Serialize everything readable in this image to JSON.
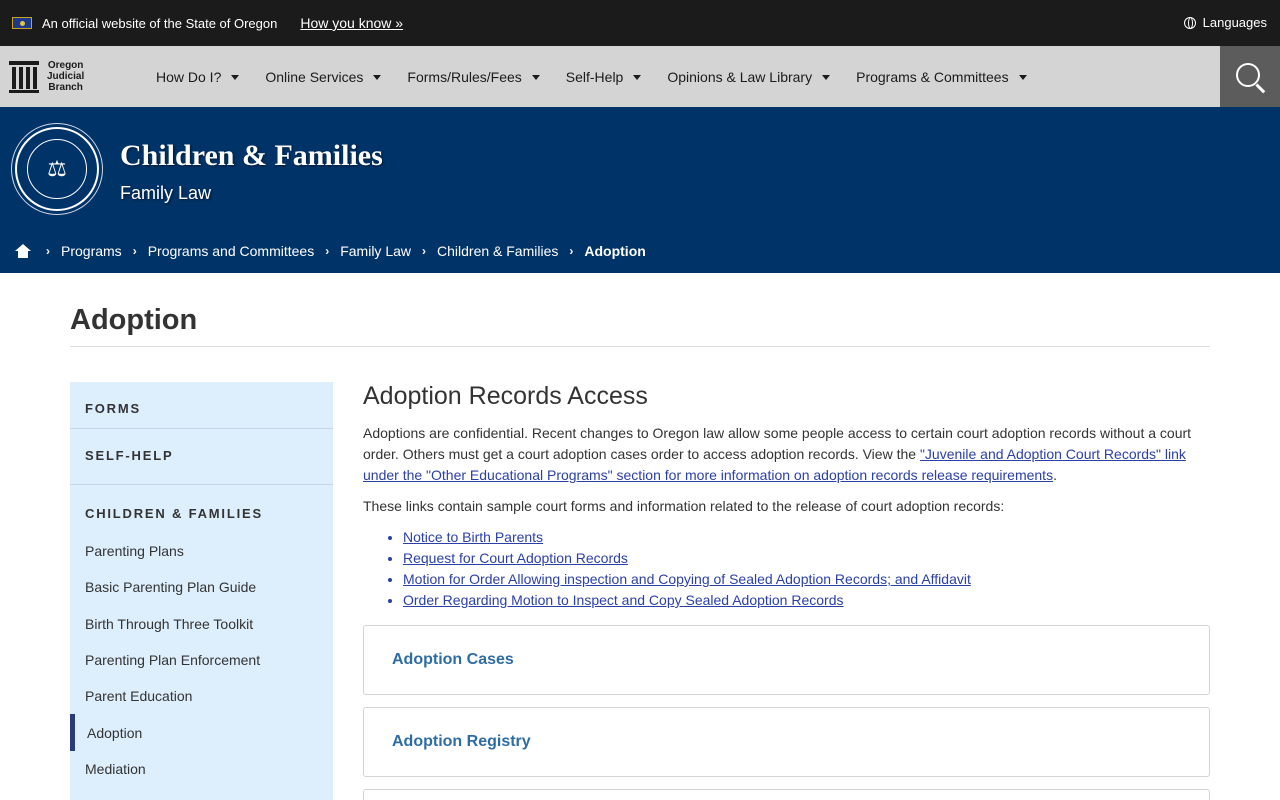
{
  "official_bar": {
    "text": "An official website of the State of Oregon",
    "how_link": "How you know »",
    "languages": "Languages"
  },
  "nav": {
    "brand_lines": [
      "Oregon",
      "Judicial",
      "Branch"
    ],
    "items": [
      "How Do I?",
      "Online Services",
      "Forms/Rules/Fees",
      "Self-Help",
      "Opinions & Law Library",
      "Programs & Committees"
    ]
  },
  "hero": {
    "title": "Children & Families",
    "subtitle": "Family Law"
  },
  "breadcrumb": [
    "Programs",
    "Programs and Committees",
    "Family Law",
    "Children & Families",
    "Adoption"
  ],
  "page_title": "Adoption",
  "sidebar": {
    "heads": [
      "FORMS",
      "SELF-HELP",
      "CHILDREN & FAMILIES"
    ],
    "items": [
      "Parenting Plans",
      "Basic Parenting Plan Guide",
      "Birth Through Three Toolkit",
      "Parenting Plan Enforcement",
      "Parent Education",
      "Adoption",
      "Mediation"
    ],
    "active_index": 5
  },
  "main": {
    "heading": "Adoption Records Access",
    "para1_text": "Adoptions are confidential. Recent changes to Oregon law allow some people access to certain court adoption records without a court order. Others must get a court adoption cases order to access adoption records. View the ",
    "para1_link": "\"Juvenile and Adoption Court Records\" link under the \"Other Educational Programs\" section for more information on adoption records release requirements",
    "para1_end": ".",
    "para2": "These links contain sample court forms and information related to the release of court adoption records:",
    "links": [
      "Notice to Birth Parents",
      "Request for Court Adoption Records",
      "Motion for Order Allowing inspection and Copying of Sealed Adoption Records; and Affidavit",
      "Order Regarding Motion to Inspect and Copy Sealed Adoption Records"
    ],
    "accordions": [
      "Adoption Cases",
      "Adoption Registry"
    ]
  }
}
